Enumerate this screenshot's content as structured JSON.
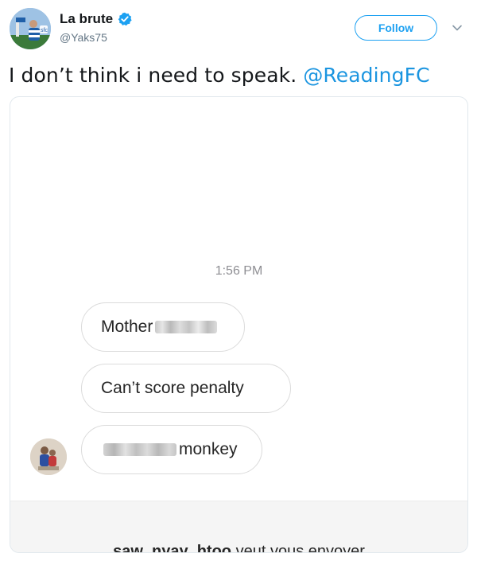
{
  "author": {
    "display_name": "La brute",
    "handle": "@Yaks75",
    "avatar_badge": "sfc",
    "verified": true
  },
  "follow_label": "Follow",
  "tweet": {
    "text": "I don’t think i need to speak. ",
    "mention": "@ReadingFC"
  },
  "dm": {
    "timestamp": "1:56 PM",
    "messages": [
      {
        "visible": "Mother",
        "redacted": true,
        "redaction_side": "after"
      },
      {
        "visible": "Can’t score penalty",
        "redacted": false
      },
      {
        "visible": "monkey",
        "redacted": true,
        "redaction_side": "before"
      }
    ],
    "footer_bold": "saw_nyay_htoo",
    "footer_rest": " veut vous envoyer"
  },
  "colors": {
    "accent": "#1da1f2",
    "mention": "#1b95e0",
    "handle_gray": "#657786",
    "bubble_border": "#dbdbdb"
  },
  "icons": [
    "verified-badge-icon",
    "chevron-down-icon"
  ]
}
